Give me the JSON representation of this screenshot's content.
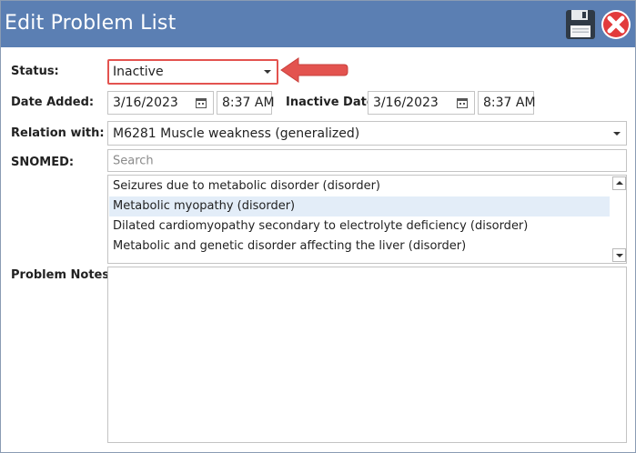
{
  "window": {
    "title": "Edit Problem List",
    "save_icon": "floppy-disk-icon",
    "close_icon": "red-circle-x-icon"
  },
  "status": {
    "label": "Status:",
    "value": "Inactive"
  },
  "date_added": {
    "label": "Date Added:",
    "date": "3/16/2023",
    "time": "8:37 AM"
  },
  "inactive_date": {
    "label": "Inactive Date:",
    "date": "3/16/2023",
    "time": "8:37 AM"
  },
  "relation": {
    "label": "Relation with:",
    "value": "M6281 Muscle weakness (generalized)"
  },
  "snomed": {
    "label": "SNOMED:",
    "placeholder": "Search",
    "results": [
      "Seizures due to metabolic disorder (disorder)",
      "Metabolic myopathy (disorder)",
      "Dilated cardiomyopathy secondary to electrolyte deficiency (disorder)",
      "Metabolic and genetic disorder affecting the liver (disorder)"
    ],
    "selected_index": 1
  },
  "problem_notes": {
    "label": "Problem Notes:",
    "value": ""
  },
  "colors": {
    "titlebar": "#5b7fb3",
    "highlight_border": "#e3534f",
    "annotation_arrow": "#e3534f",
    "selected_row": "#e3edf8"
  }
}
